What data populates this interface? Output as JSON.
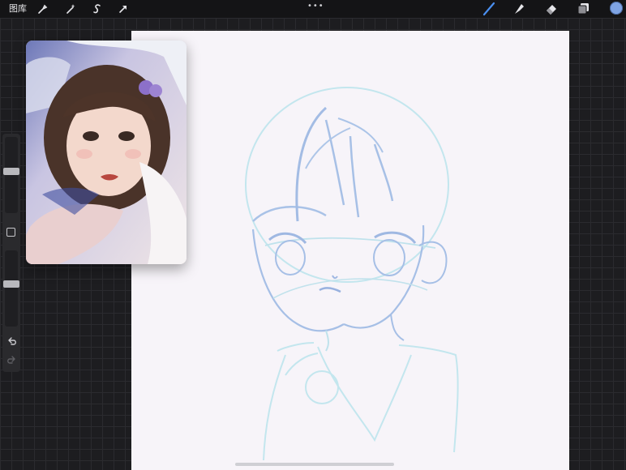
{
  "topbar": {
    "gallery_label": "图库",
    "tools_left": [
      "wrench-icon",
      "magic-wand-icon",
      "selection-s-icon",
      "transform-arrow-icon"
    ],
    "tools_right": [
      "brush-icon",
      "smudge-icon",
      "eraser-icon",
      "layers-icon"
    ],
    "more_glyph": "•••",
    "active_color": "#7fa4e4"
  },
  "sidebar": {
    "brush_size_level": 0.18,
    "opacity_level": 0.45
  },
  "colors": {
    "canvas": "#f7f4f9",
    "sketch_blue": "#a8c3e6",
    "sketch_cyan": "#bfe3ec"
  }
}
